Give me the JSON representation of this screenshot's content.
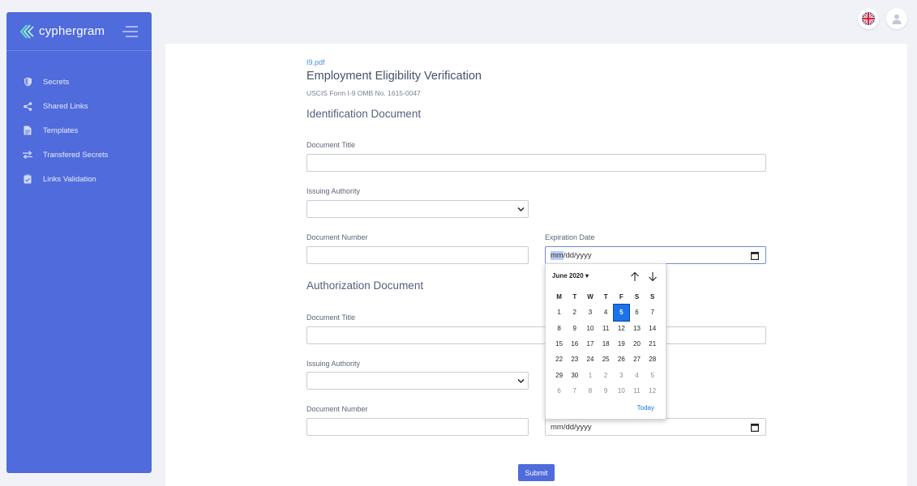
{
  "brand": {
    "name": "cyphergram"
  },
  "sidebar": {
    "items": [
      {
        "label": "Secrets",
        "icon": "shield-icon"
      },
      {
        "label": "Shared Links",
        "icon": "share-icon"
      },
      {
        "label": "Templates",
        "icon": "document-icon"
      },
      {
        "label": "Transfered Secrets",
        "icon": "transfer-icon"
      },
      {
        "label": "Links Validation",
        "icon": "clipboard-check-icon"
      }
    ]
  },
  "header": {
    "language": "uk-flag-icon",
    "user": "user-icon"
  },
  "form": {
    "file": "I9.pdf",
    "title": "Employment Eligibility Verification",
    "subtitle": "USCIS Form I-9 OMB No. 1615-0047",
    "sections": [
      {
        "title": "Identification Document",
        "document_title_label": "Document Title",
        "issuing_authority_label": "Issuing Authority",
        "document_number_label": "Document Number",
        "expiration_date_label": "Expiration Date",
        "expiration_date_placeholder": "mm/dd/yyyy"
      },
      {
        "title": "Authorization Document",
        "document_title_label": "Document Title",
        "issuing_authority_label": "Issuing Authority",
        "document_number_label": "Document Number",
        "expiration_date_placeholder": "mm/dd/yyyy"
      }
    ],
    "submit_label": "Submit"
  },
  "datepicker": {
    "month_label": "June 2020",
    "weekdays": [
      "M",
      "T",
      "W",
      "T",
      "F",
      "S",
      "S"
    ],
    "days": [
      [
        "1",
        "2",
        "3",
        "4",
        "5",
        "6",
        "7"
      ],
      [
        "8",
        "9",
        "10",
        "11",
        "12",
        "13",
        "14"
      ],
      [
        "15",
        "16",
        "17",
        "18",
        "19",
        "20",
        "21"
      ],
      [
        "22",
        "23",
        "24",
        "25",
        "26",
        "27",
        "28"
      ],
      [
        "29",
        "30",
        "1",
        "2",
        "3",
        "4",
        "5"
      ],
      [
        "6",
        "7",
        "8",
        "9",
        "10",
        "11",
        "12"
      ]
    ],
    "selected_day": "5",
    "today_label": "Today"
  },
  "colors": {
    "primary": "#4f6bdc",
    "link": "#4a90d9",
    "selected": "#1a73e8"
  }
}
